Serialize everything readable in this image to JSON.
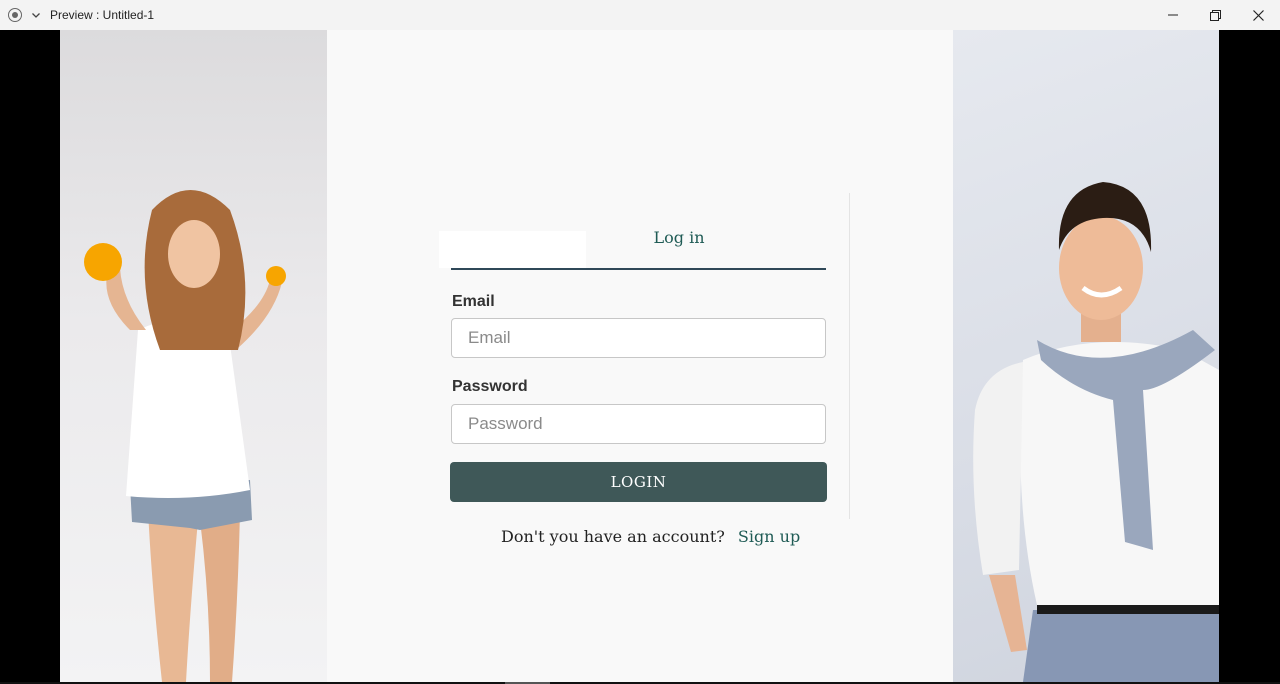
{
  "window": {
    "title": "Preview : Untitled-1",
    "controls": [
      "minimize",
      "restore",
      "close"
    ]
  },
  "auth": {
    "tab_login_label": "Log in",
    "email_label": "Email",
    "email_placeholder": "Email",
    "email_value": "",
    "password_label": "Password",
    "password_placeholder": "Password",
    "password_value": "",
    "login_button_label": "LOGIN",
    "signup_prompt": "Don't you have an account?",
    "signup_link": "Sign up"
  },
  "colors": {
    "accent": "#1f5b55",
    "button": "#3f5858",
    "underline": "#2f4858",
    "panel_bg": "#f9f9f9"
  },
  "images": {
    "left": "woman-holding-oranges-photo",
    "right": "smiling-man-with-sweater-photo"
  }
}
